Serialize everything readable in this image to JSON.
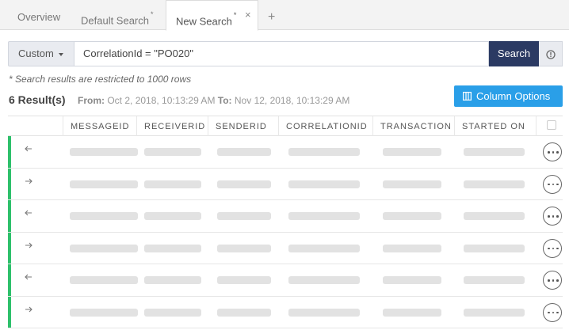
{
  "tabs": [
    {
      "label": "Overview",
      "modified": ""
    },
    {
      "label": "Default Search",
      "modified": "*"
    },
    {
      "label": "New Search",
      "modified": "*",
      "close": "×"
    }
  ],
  "tab_add": "+",
  "search": {
    "mode": "Custom",
    "query": "CorrelationId = \"PO020\"",
    "button": "Search"
  },
  "note": "* Search results are restricted to 1000 rows",
  "summary": {
    "count": "6 Result(s)",
    "from_label": "From:",
    "from_value": "Oct 2, 2018, 10:13:29 AM",
    "to_label": "To:",
    "to_value": "Nov 12, 2018, 10:13:29 AM"
  },
  "column_options": "Column Options",
  "columns": [
    "MESSAGEID",
    "RECEIVERID",
    "SENDERID",
    "CORRELATIONID",
    "TRANSACTION",
    "STARTED ON"
  ],
  "rows": [
    {
      "direction": "inbound"
    },
    {
      "direction": "outbound"
    },
    {
      "direction": "inbound"
    },
    {
      "direction": "outbound"
    },
    {
      "direction": "inbound"
    },
    {
      "direction": "outbound"
    }
  ],
  "colors": {
    "search_button": "#2b3a63",
    "column_options_button": "#2a9fe8",
    "status_bar": "#2ec06b"
  }
}
